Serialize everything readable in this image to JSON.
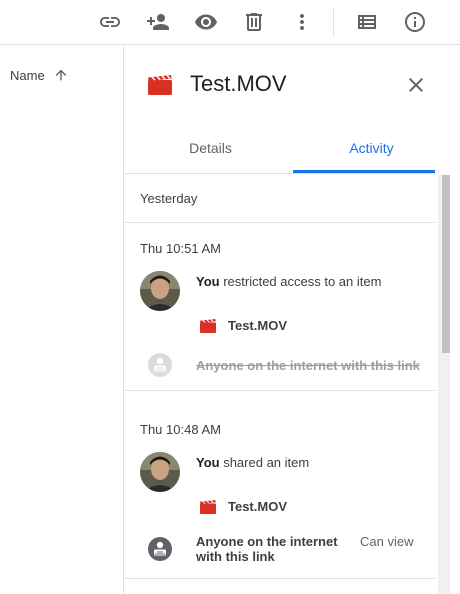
{
  "toolbar": {
    "icons": [
      "link-icon",
      "add-person-icon",
      "eye-icon",
      "trash-icon",
      "more-vert-icon",
      "list-view-icon",
      "info-icon"
    ]
  },
  "sort": {
    "label": "Name"
  },
  "file": {
    "name": "Test.MOV"
  },
  "tabs": [
    {
      "label": "Details",
      "active": false
    },
    {
      "label": "Activity",
      "active": true
    }
  ],
  "section_label": "Yesterday",
  "activities": [
    {
      "time": "Thu 10:51 AM",
      "actor": "You",
      "action_text": " restricted access to an item",
      "file_name": "Test.MOV",
      "permission_text": "Anyone on the internet with this link"
    },
    {
      "time": "Thu 10:48 AM",
      "actor": "You",
      "action_text": " shared an item",
      "file_name": "Test.MOV",
      "permission_text": "Anyone on the internet with this link",
      "permission_role": "Can view"
    }
  ],
  "colors": {
    "accent": "#1a73e8",
    "file_icon": "#d93025",
    "icon_gray": "#5f6368"
  }
}
